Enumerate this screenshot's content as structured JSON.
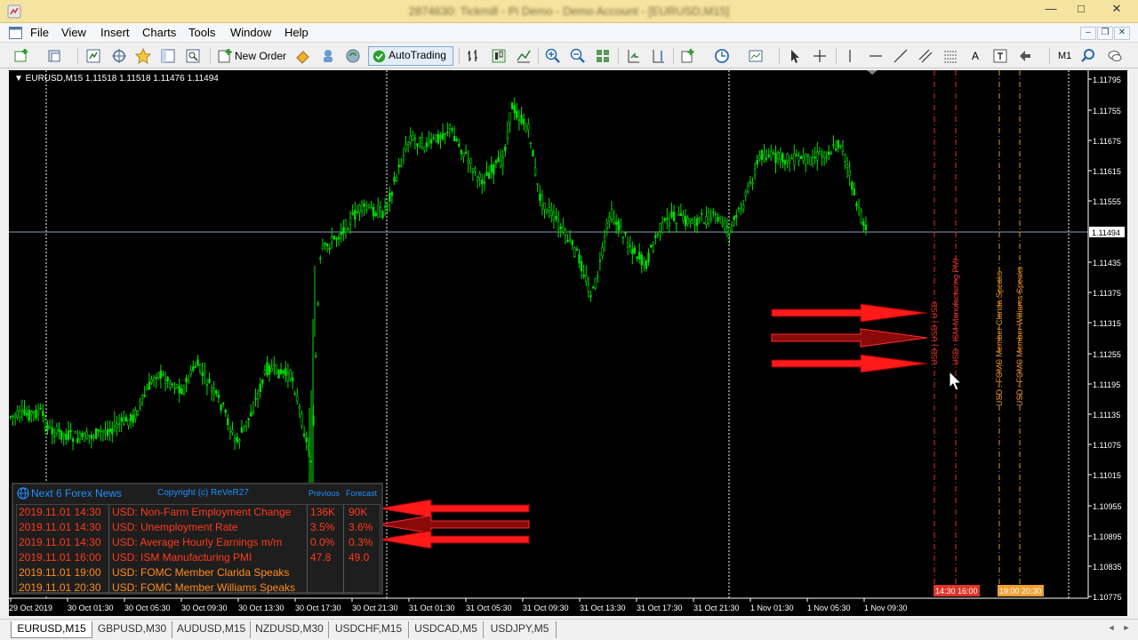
{
  "window": {
    "title": "2874630: Tickmill - Pi Demo - Demo Account - [EURUSD,M15]",
    "minimize": "—",
    "maximize": "□",
    "close": "✕"
  },
  "menu": {
    "items": [
      "File",
      "View",
      "Insert",
      "Charts",
      "Tools",
      "Window",
      "Help"
    ],
    "mdi_min": "–",
    "mdi_restore": "❐",
    "mdi_close": "✕"
  },
  "toolbar": {
    "new_order": "New Order",
    "autotrading": "AutoTrading",
    "timeframe": "M1",
    "text_tool": "A"
  },
  "chart": {
    "symbol_info": "▼ EURUSD,M15  1.11518 1.11518 1.11476 1.11494",
    "price_ticks": [
      "1.11795",
      "1.11755",
      "1.11675",
      "1.11615",
      "1.11555",
      "1.11494",
      "1.11435",
      "1.11375",
      "1.11315",
      "1.11255",
      "1.11195",
      "1.11135",
      "1.11075",
      "1.11015",
      "1.10955",
      "1.10895",
      "1.10835",
      "1.10775"
    ],
    "current_price": "1.11494",
    "time_ticks": [
      "29 Oct 2019",
      "30 Oct 01:30",
      "30 Oct 05:30",
      "30 Oct 09:30",
      "30 Oct 13:30",
      "30 Oct 17:30",
      "30 Oct 21:30",
      "31 Oct 01:30",
      "31 Oct 05:30",
      "31 Oct 09:30",
      "31 Oct 13:30",
      "31 Oct 17:30",
      "31 Oct 21:30",
      "1 Nov 01:30",
      "1 Nov 05:30",
      "1 Nov 09:30"
    ],
    "event_lines": [
      {
        "label": "USD | USD | USD",
        "color": "#e0342a"
      },
      {
        "label": "USD : ISM Manufacturing PMI",
        "color": "#e0342a"
      },
      {
        "label": "USD : FOMC Member Clarida Speaks",
        "color": "#e8902a"
      },
      {
        "label": "USD : FOMC Member Williams Speaks",
        "color": "#e8902a"
      }
    ],
    "time_badges": [
      {
        "text": "14:30 16:00",
        "color": "#e0342a"
      },
      {
        "text": "19:00 20:30",
        "color": "#f0a030"
      }
    ],
    "colors": {
      "candle": "#00dd00",
      "background": "#000000",
      "grid": "#ffffff",
      "arrow": "#ff0000"
    }
  },
  "news": {
    "title": "Next 6 Forex News",
    "copyright": "Copyright (c) ReVeR27",
    "previous_header": "Previous",
    "forecast_header": "Forecast",
    "rows": [
      {
        "time": "2019.11.01 14:30",
        "event": "USD: Non-Farm Employment Change",
        "previous": "136K",
        "forecast": "90K",
        "color": "#ff3a1a"
      },
      {
        "time": "2019.11.01 14:30",
        "event": "USD: Unemployment Rate",
        "previous": "3.5%",
        "forecast": "3.6%",
        "color": "#ff3a1a"
      },
      {
        "time": "2019.11.01 14:30",
        "event": "USD: Average Hourly Earnings m/m",
        "previous": "0.0%",
        "forecast": "0.3%",
        "color": "#ff3a1a"
      },
      {
        "time": "2019.11.01 16:00",
        "event": "USD: ISM Manufacturing PMI",
        "previous": "47.8",
        "forecast": "49.0",
        "color": "#ff3a1a"
      },
      {
        "time": "2019.11.01 19:00",
        "event": "USD: FOMC Member Clarida Speaks",
        "previous": "",
        "forecast": "",
        "color": "#ff8c1a"
      },
      {
        "time": "2019.11.01 20:30",
        "event": "USD: FOMC Member Williams Speaks",
        "previous": "",
        "forecast": "",
        "color": "#ff8c1a"
      }
    ]
  },
  "tabs": [
    "EURUSD,M15",
    "GBPUSD,M30",
    "AUDUSD,M15",
    "NZDUSD,M30",
    "USDCHF,M15",
    "USDCAD,M5",
    "USDJPY,M5"
  ],
  "tab_arrows": [
    "◄",
    "►"
  ]
}
